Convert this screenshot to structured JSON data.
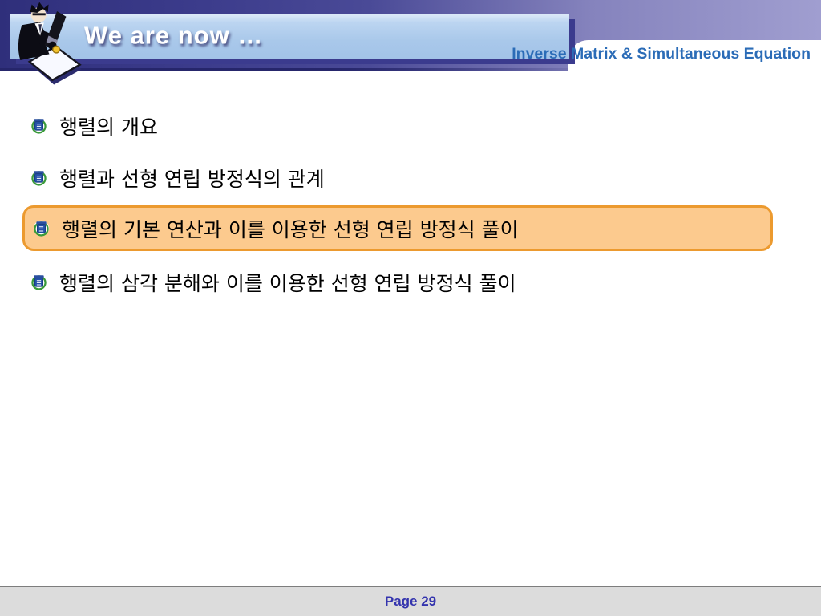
{
  "header": {
    "title": "We are now …",
    "subtitle": "Inverse Matrix & Simultaneous Equation"
  },
  "bullets": [
    {
      "text": "행렬의 개요",
      "highlighted": false
    },
    {
      "text": "행렬과 선형 연립 방정식의 관계",
      "highlighted": false
    },
    {
      "text": "행렬의 기본 연산과 이를 이용한 선형 연립 방정식 풀이",
      "highlighted": true
    },
    {
      "text": "행렬의 삼각 분해와 이를 이용한 선형 연립 방정식 풀이",
      "highlighted": false
    }
  ],
  "footer": {
    "page_label": "Page 29"
  },
  "icons": {
    "bullet_icon": "university-emblem-icon",
    "header_icon": "person-writing-clipart-icon"
  },
  "colors": {
    "header_gradient_left": "#2F2F7B",
    "header_gradient_right": "#A09ED0",
    "banner_fill": "#A9C8EA",
    "banner_shadow": "#3B3B8E",
    "subtitle_blue": "#2B6CB7",
    "highlight_fill": "#FCCA8E",
    "highlight_border": "#EC9A2F",
    "footer_background": "#DCDCDC",
    "footer_text": "#3434AE",
    "body_text": "#000000"
  }
}
